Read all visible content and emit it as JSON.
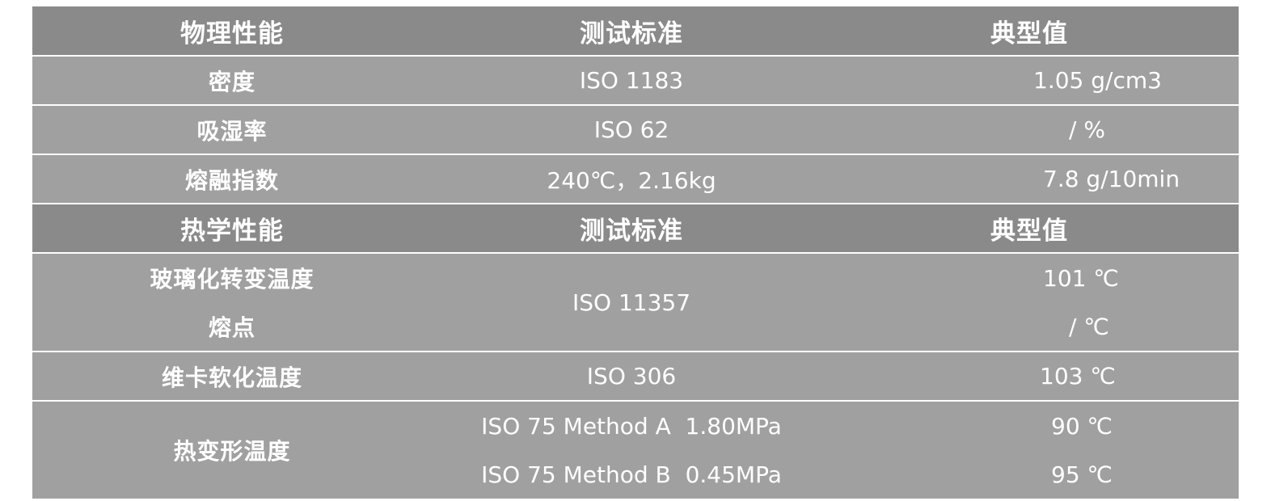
{
  "physical": {
    "header": {
      "property": "物理性能",
      "standard": "测试标准",
      "value": "典型值"
    },
    "rows": [
      {
        "property": "密度",
        "standard": "ISO 1183",
        "value": "1.05 g/cm3"
      },
      {
        "property": "吸湿率",
        "standard": "ISO 62",
        "value": "/ %"
      },
      {
        "property": "熔融指数",
        "standard": "240℃，2.16kg",
        "value": "7.8 g/10min"
      }
    ]
  },
  "thermal": {
    "header": {
      "property": "热学性能",
      "standard": "测试标准",
      "value": "典型值"
    },
    "glass": {
      "property": "玻璃化转变温度",
      "value": "101 ℃"
    },
    "melting": {
      "property": "熔点",
      "value": "/ ℃"
    },
    "glass_melting_standard": "ISO 11357",
    "vicat": {
      "property": "维卡软化温度",
      "standard": "ISO 306",
      "value": "103 ℃"
    },
    "hdt": {
      "property": "热变形温度",
      "method_a": {
        "standard": "ISO 75 Method A  1.80MPa",
        "value": "90 ℃"
      },
      "method_b": {
        "standard": "ISO 75 Method B  0.45MPa",
        "value": "95 ℃"
      }
    }
  }
}
